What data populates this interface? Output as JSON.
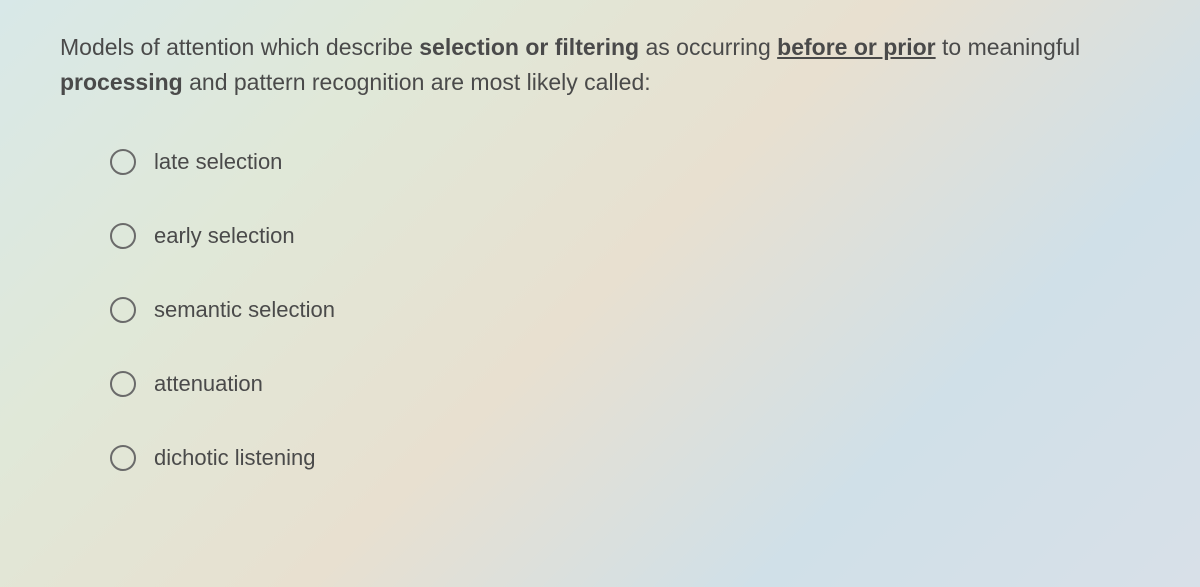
{
  "question": {
    "part1": "Models of attention which describe ",
    "bold1": "selection or filtering",
    "part2": " as occurring ",
    "underline1": "before or prior",
    "part3": " to meaningful ",
    "bold2": "processing",
    "part4": " and pattern recognition are most likely called:"
  },
  "options": [
    {
      "label": "late selection"
    },
    {
      "label": "early selection"
    },
    {
      "label": "semantic selection"
    },
    {
      "label": "attenuation"
    },
    {
      "label": "dichotic listening"
    }
  ]
}
